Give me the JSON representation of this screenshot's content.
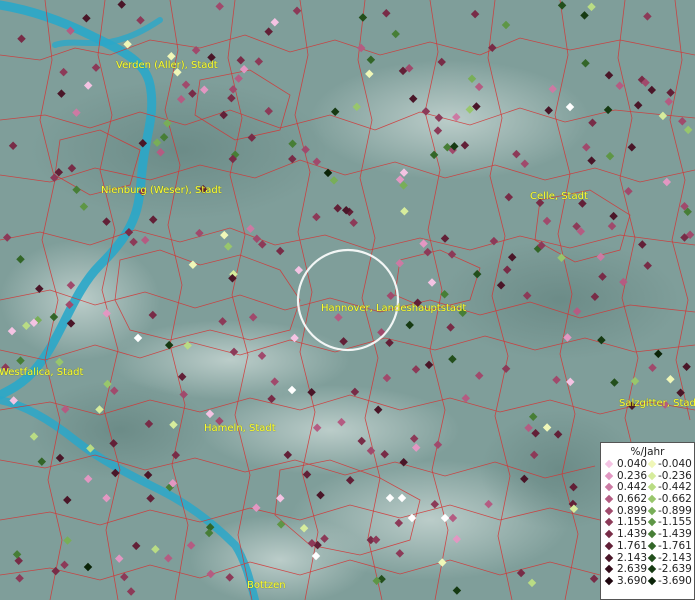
{
  "map": {
    "cities": [
      {
        "name": "Verden (Aller), Stadt",
        "at": [
          116,
          60
        ]
      },
      {
        "name": "Nienburg (Weser), Stadt",
        "at": [
          101,
          185
        ]
      },
      {
        "name": "Celle, Stadt",
        "at": [
          530,
          191
        ]
      },
      {
        "name": "Hannover, Landeshauptstadt",
        "at": [
          321,
          303
        ]
      },
      {
        "name": "Westfalica, Stadt",
        "at": [
          -1,
          367
        ]
      },
      {
        "name": "Hameln, Stadt",
        "at": [
          204,
          423
        ]
      },
      {
        "name": "Salzgitter, Stadt",
        "at": [
          619,
          398
        ]
      },
      {
        "name": "Bottzen",
        "at": [
          247,
          580
        ]
      }
    ],
    "colors": {
      "terrain": "#7f9e9a",
      "river": "#2aa7c9",
      "boundary": "#d23535",
      "label": "#ffff33"
    }
  },
  "legend": {
    "title": "%/Jahr",
    "positive": [
      {
        "value": "0.040",
        "color": "#f4c3e3"
      },
      {
        "value": "0.236",
        "color": "#e297c2"
      },
      {
        "value": "0.442",
        "color": "#cc7aa3"
      },
      {
        "value": "0.662",
        "color": "#b45c82"
      },
      {
        "value": "0.899",
        "color": "#a04a6c"
      },
      {
        "value": "1.155",
        "color": "#8c3a58"
      },
      {
        "value": "1.439",
        "color": "#782c47"
      },
      {
        "value": "1.761",
        "color": "#622037"
      },
      {
        "value": "2.143",
        "color": "#4a1628"
      },
      {
        "value": "2.639",
        "color": "#340d1b"
      },
      {
        "value": "3.690",
        "color": "#1e050e"
      }
    ],
    "negative": [
      {
        "value": "-0.040",
        "color": "#f0f7b8"
      },
      {
        "value": "-0.236",
        "color": "#d6ec9c"
      },
      {
        "value": "-0.442",
        "color": "#b9dc84"
      },
      {
        "value": "-0.662",
        "color": "#98c66c"
      },
      {
        "value": "-0.899",
        "color": "#78ae58"
      },
      {
        "value": "-1.155",
        "color": "#5e9646"
      },
      {
        "value": "-1.439",
        "color": "#477e36"
      },
      {
        "value": "-1.761",
        "color": "#336628"
      },
      {
        "value": "-2.143",
        "color": "#234f1c"
      },
      {
        "value": "-2.639",
        "color": "#163a12"
      },
      {
        "value": "-3.690",
        "color": "#0b2408"
      }
    ]
  }
}
